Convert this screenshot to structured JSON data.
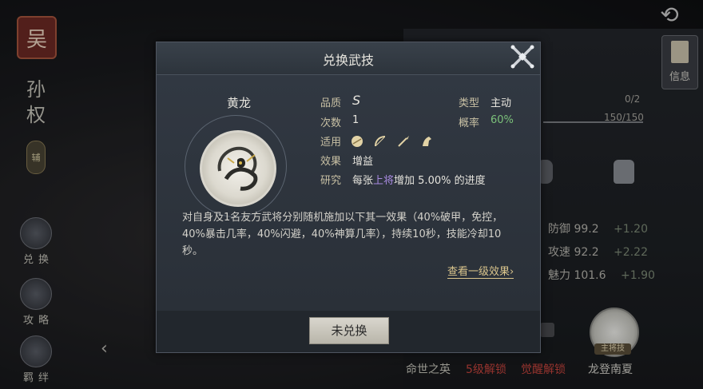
{
  "background": {
    "faction_char": "吴",
    "hero_name": "孙权",
    "role_badge": "辅",
    "side_buttons": [
      "兑换",
      "攻略",
      "羁绊"
    ],
    "info_label": "信息",
    "progress_count": "0/2",
    "progress_exp": "150/150",
    "stats": [
      {
        "label": "防御",
        "value": "99.2",
        "inc": "+1.20"
      },
      {
        "label": "攻速",
        "value": "92.2",
        "inc": "+2.22"
      },
      {
        "label": "魅力",
        "value": "101.6",
        "inc": "+1.90"
      }
    ],
    "skill_tag": "主将技",
    "bottom_labels": [
      {
        "text": "命世之英",
        "color": "#c9c7bd"
      },
      {
        "text": "5级解锁",
        "color": "#c9453e"
      },
      {
        "text": "觉醒解锁",
        "color": "#c9453e"
      },
      {
        "text": "龙登南夏",
        "color": "#d8d6cf"
      }
    ]
  },
  "dialog": {
    "title": "兑换武技",
    "skill_name": "黄龙",
    "fields": {
      "quality_label": "品质",
      "quality_value": "S",
      "type_label": "类型",
      "type_value": "主动",
      "count_label": "次数",
      "count_value": "1",
      "rate_label": "概率",
      "rate_value": "60%",
      "apply_label": "适用",
      "effect_label": "效果",
      "effect_value": "增益",
      "research_label": "研究",
      "research_pre": "每张",
      "research_highlight": "上将",
      "research_post": "增加 5.00% 的进度"
    },
    "apply_icons": [
      "shield-icon",
      "bow-icon",
      "spear-icon",
      "horse-icon"
    ],
    "description": "对自身及1名友方武将分别随机施加以下其一效果（40%破甲，免控，40%暴击几率，40%闪避，40%神算几率），持续10秒，技能冷却10秒。",
    "more_link": "查看一级效果",
    "exchange_button": "未兑换"
  },
  "colors": {
    "accent_green": "#7cc17a",
    "highlight_purple": "#a88ae0",
    "link_gold": "#d9c48c",
    "lock_red": "#c9453e"
  }
}
